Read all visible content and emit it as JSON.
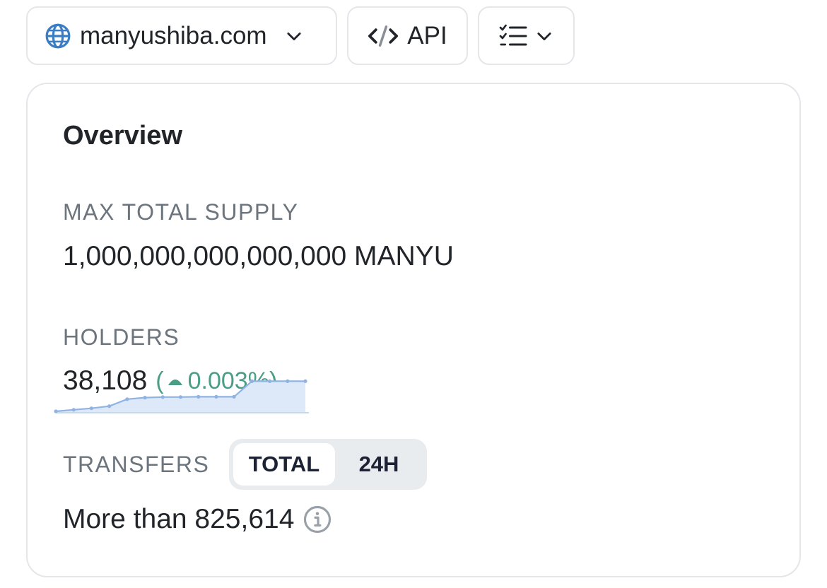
{
  "toolbar": {
    "site_label": "manyushiba.com",
    "site_icon": "globe-icon",
    "api_label": "API",
    "api_icon": "code-icon",
    "list_icon": "checklist-icon"
  },
  "overview": {
    "title": "Overview",
    "max_supply_label": "MAX TOTAL SUPPLY",
    "max_supply_value": "1,000,000,000,000,000 MANYU",
    "holders_label": "HOLDERS",
    "holders_value": "38,108",
    "holders_change_open": "(",
    "holders_change": "0.003%)",
    "transfers_label": "TRANSFERS",
    "transfers_tabs": [
      "TOTAL",
      "24H"
    ],
    "transfers_active_tab": "TOTAL",
    "transfers_value": "More than 825,614"
  },
  "colors": {
    "positive": "#4a9e86",
    "sparkline_line": "#8fb4e3",
    "sparkline_fill": "#dde9f8",
    "border": "#e4e6ea"
  },
  "chart_data": {
    "type": "area",
    "values": [
      0.0,
      0.05,
      0.1,
      0.17,
      0.4,
      0.45,
      0.47,
      0.47,
      0.48,
      0.48,
      0.48,
      0.99,
      0.99,
      0.99,
      0.99
    ],
    "title": "",
    "xlabel": "",
    "ylabel": "",
    "grid": false
  }
}
